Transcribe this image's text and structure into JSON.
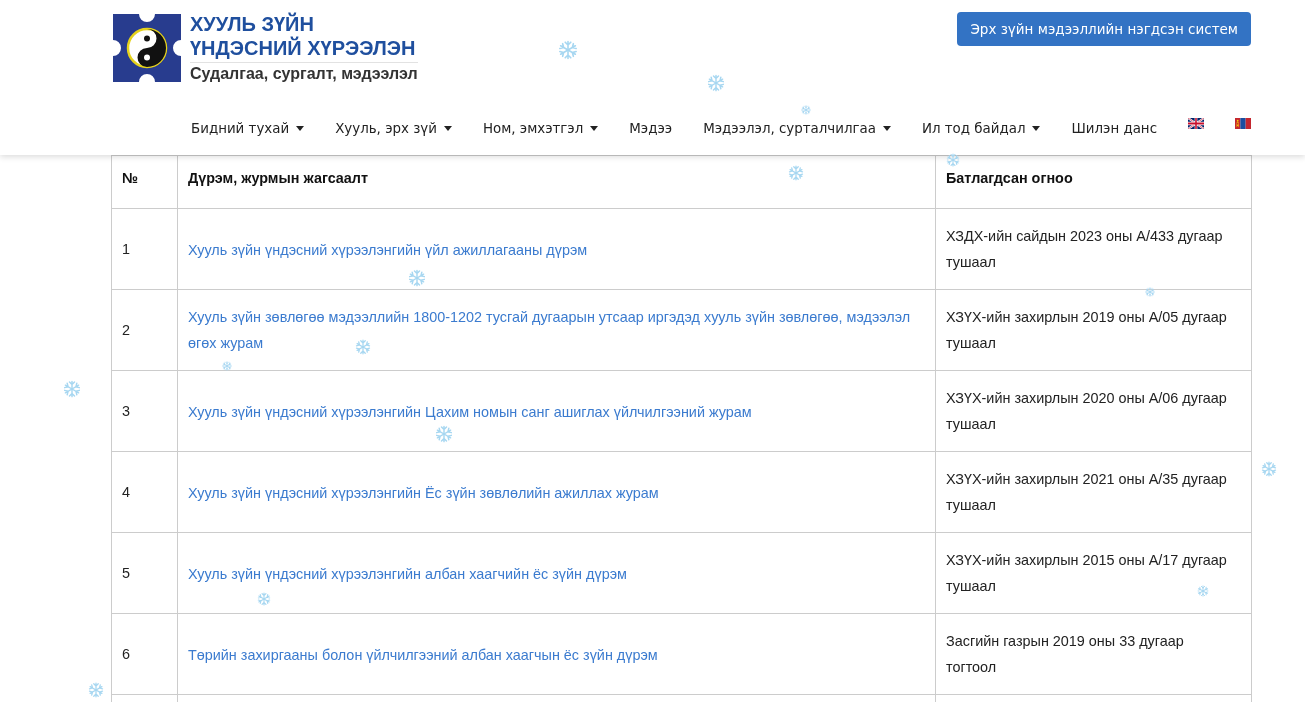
{
  "header": {
    "logo": {
      "title_lines": [
        "ХУУЛЬ ЗҮЙН",
        "ҮНДЭСНИЙ ХҮРЭЭЛЭН"
      ],
      "subtitle": "Судалгаа, сургалт, мэдээлэл"
    },
    "system_button": {
      "label": "Эрх зүйн мэдээллийн нэгдсэн систем"
    },
    "nav": [
      {
        "label": "Бидний тухай",
        "dropdown": true
      },
      {
        "label": "Хууль, эрх зүй",
        "dropdown": true
      },
      {
        "label": "Ном, эмхэтгэл",
        "dropdown": true
      },
      {
        "label": "Мэдээ",
        "dropdown": false
      },
      {
        "label": "Мэдээлэл, сурталчилгаа",
        "dropdown": true
      },
      {
        "label": "Ил тод байдал",
        "dropdown": true
      },
      {
        "label": "Шилэн данс",
        "dropdown": false
      }
    ],
    "languages": [
      {
        "kind": "english"
      },
      {
        "kind": "mongolian"
      }
    ]
  },
  "table": {
    "columns": [
      "№",
      "Дүрэм, журмын жагсаалт",
      "Батлагдсан огноо"
    ],
    "rows": [
      {
        "number": "1",
        "title": "Хууль зүйн үндэсний хүрээлэнгийн үйл ажиллагааны дүрэм",
        "approved": "ХЗДХ-ийн сайдын 2023 оны А/433 дугаар тушаал"
      },
      {
        "number": "2",
        "title": "Хууль зүйн зөвлөгөө мэдээллийн 1800-1202 тусгай дугаарын утсаар иргэдэд хууль зүйн зөвлөгөө, мэдээлэл өгөх журам",
        "approved": "ХЗҮХ-ийн захирлын 2019 оны А/05 дугаар тушаал"
      },
      {
        "number": "3",
        "title": "Хууль зүйн үндэсний хүрээлэнгийн Цахим номын санг ашиглах үйлчилгээний журам",
        "approved": "ХЗҮХ-ийн захирлын 2020 оны А/06 дугаар тушаал"
      },
      {
        "number": "4",
        "title": "Хууль зүйн үндэсний хүрээлэнгийн Ёс зүйн зөвлөлийн ажиллах журам",
        "approved": "ХЗҮХ-ийн захирлын 2021 оны А/35 дугаар тушаал"
      },
      {
        "number": "5",
        "title": "Хууль зүйн үндэсний хүрээлэнгийн албан хаагчийн ёс зүйн дүрэм",
        "approved": "ХЗҮХ-ийн захирлын 2015 оны А/17 дугаар тушаал"
      },
      {
        "number": "6",
        "title": "Төрийн захиргааны болон үйлчилгээний албан хаагчын ёс зүйн дүрэм",
        "approved": "Засгийн газрын 2019 оны 33 дугаар тогтоол"
      }
    ]
  }
}
